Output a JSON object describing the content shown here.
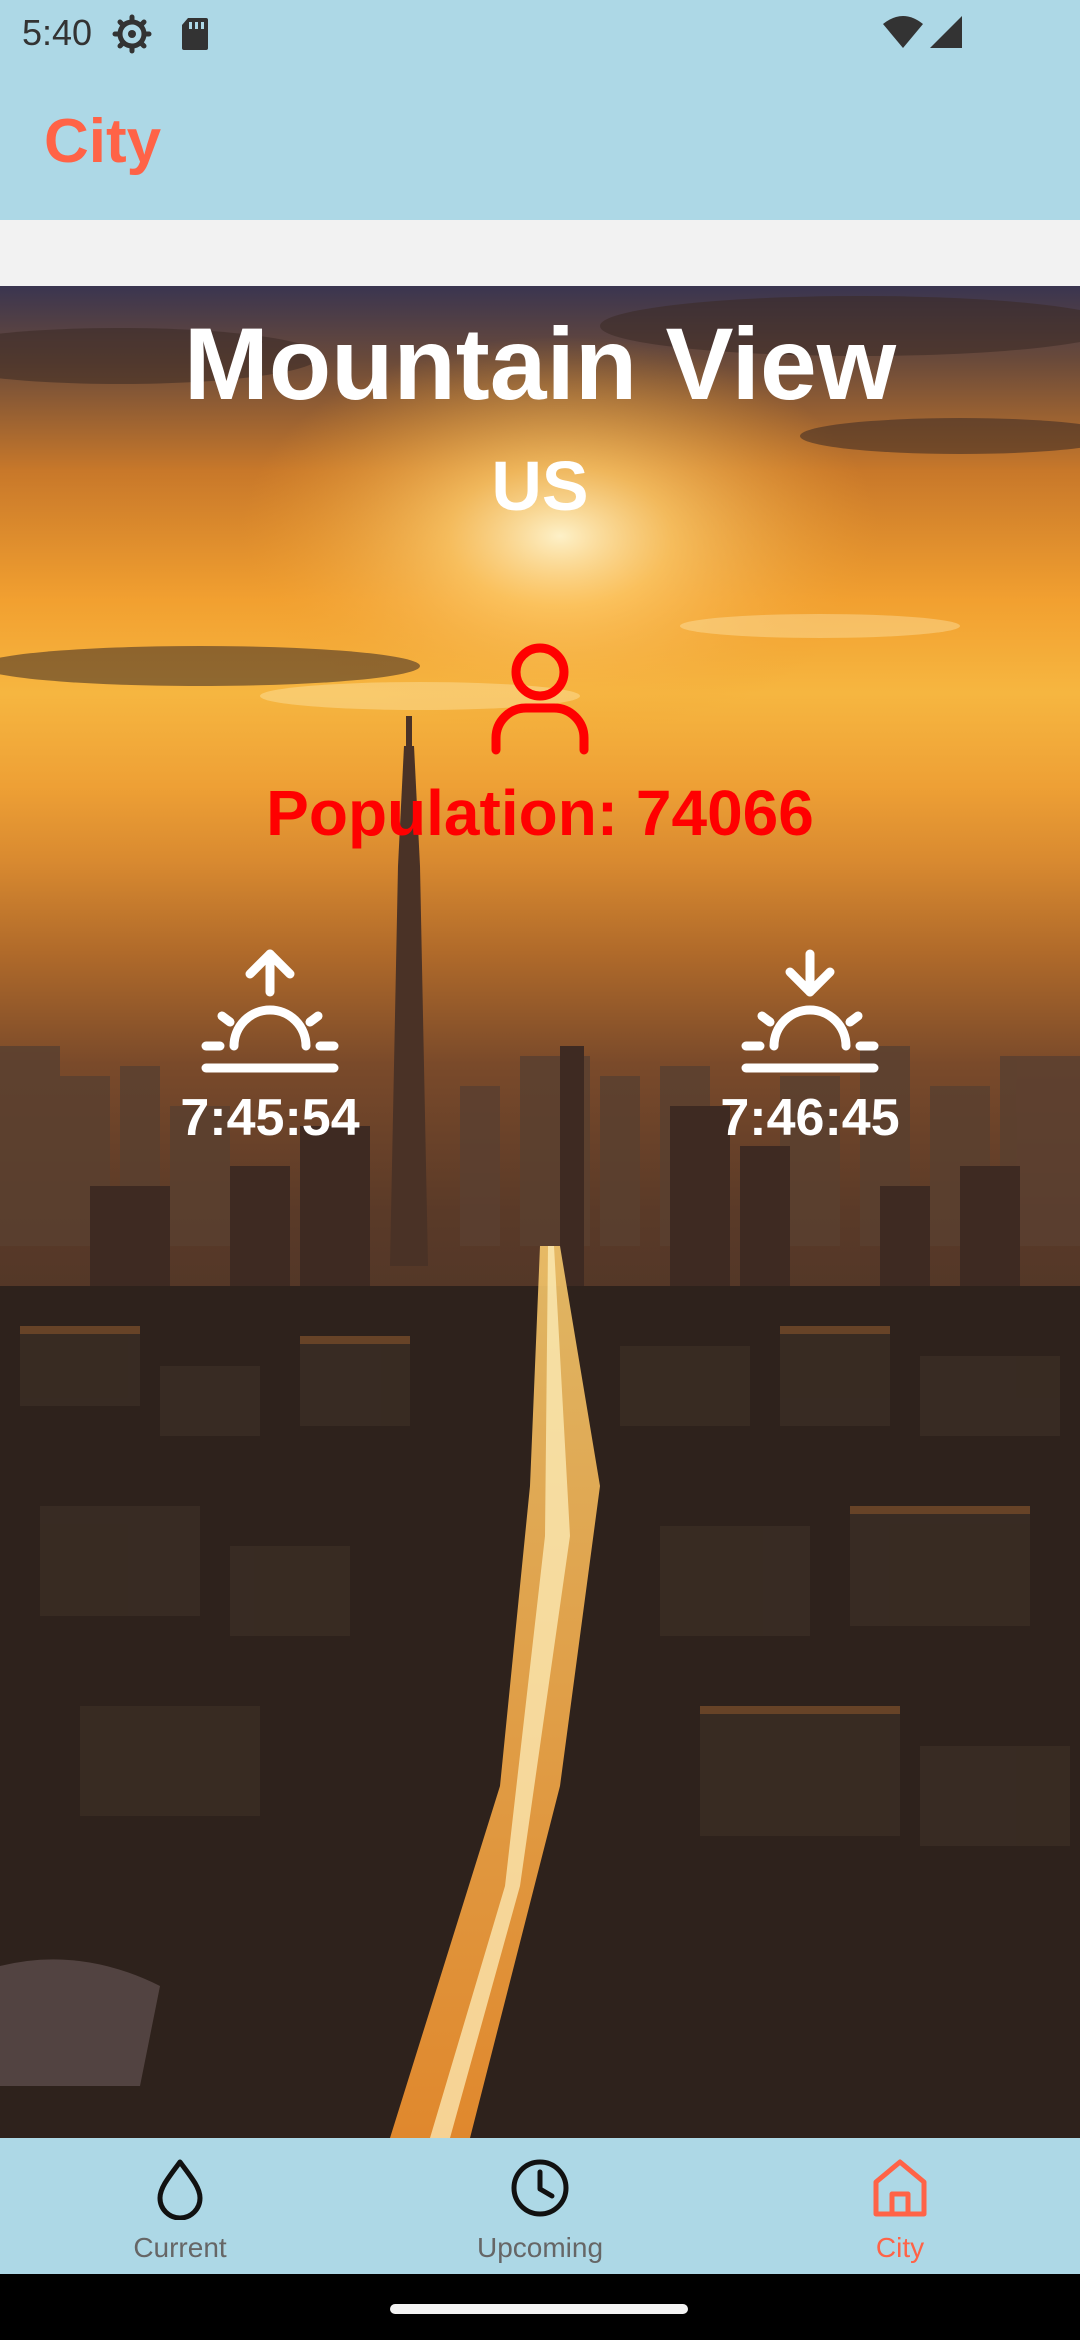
{
  "status_bar": {
    "time": "5:40",
    "icons": [
      "gear-icon",
      "sim-card-icon",
      "wifi-icon",
      "cell-signal-icon"
    ]
  },
  "app_bar": {
    "title": "City"
  },
  "city": {
    "name": "Mountain View",
    "country": "US",
    "population_label": "Population: 74066",
    "sunrise_time": "7:45:54",
    "sunset_time": "7:46:45"
  },
  "bottom_nav": {
    "items": [
      {
        "label": "Current",
        "icon": "water-drop-icon",
        "active": false
      },
      {
        "label": "Upcoming",
        "icon": "clock-icon",
        "active": false
      },
      {
        "label": "City",
        "icon": "home-icon",
        "active": true
      }
    ]
  },
  "colors": {
    "bar_background": "#add8e6",
    "accent": "#ff6347",
    "population_text": "#ff0000",
    "nav_inactive": "#666666"
  }
}
